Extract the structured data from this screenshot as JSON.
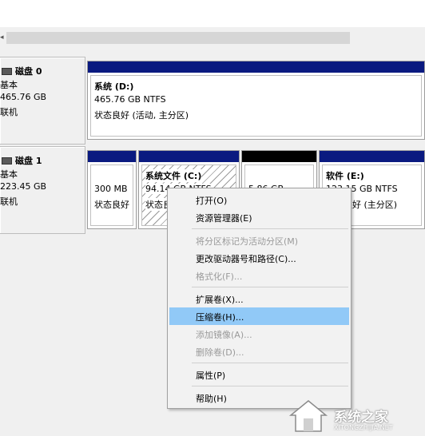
{
  "disks": [
    {
      "name": "磁盘 0",
      "type": "基本",
      "size": "465.76 GB",
      "status": "联机"
    },
    {
      "name": "磁盘 1",
      "type": "基本",
      "size": "223.45 GB",
      "status": "联机"
    }
  ],
  "disk0_partition": {
    "title": "系统 (D:)",
    "size": "465.76 GB NTFS",
    "status": "状态良好 (活动, 主分区)"
  },
  "disk1_partitions": [
    {
      "size": "300 MB",
      "status": "状态良好"
    },
    {
      "title": "系统文件 (C:)",
      "size": "94.14 GB NTFS",
      "status": "状态良"
    },
    {
      "size": "5.86 GB"
    },
    {
      "title": "软件 (E:)",
      "size": "123.15 GB NTFS",
      "status": "状态良好 (主分区)"
    }
  ],
  "context_menu": {
    "items": [
      {
        "label": "打开(O)",
        "enabled": true
      },
      {
        "label": "资源管理器(E)",
        "enabled": true
      },
      {
        "label": "将分区标记为活动分区(M)",
        "enabled": false
      },
      {
        "label": "更改驱动器号和路径(C)...",
        "enabled": true
      },
      {
        "label": "格式化(F)...",
        "enabled": false
      },
      {
        "label": "扩展卷(X)...",
        "enabled": true
      },
      {
        "label": "压缩卷(H)...",
        "enabled": true,
        "highlighted": true
      },
      {
        "label": "添加镜像(A)...",
        "enabled": false
      },
      {
        "label": "删除卷(D)...",
        "enabled": false
      },
      {
        "label": "属性(P)",
        "enabled": true
      },
      {
        "label": "帮助(H)",
        "enabled": true
      }
    ]
  },
  "watermark": {
    "text": "系统之家",
    "sub": "XITONGZHIJIA.NET"
  },
  "colors": {
    "primary_stripe": "#0a1a80",
    "unallocated_stripe": "#000000",
    "highlight": "#91c9f7"
  }
}
